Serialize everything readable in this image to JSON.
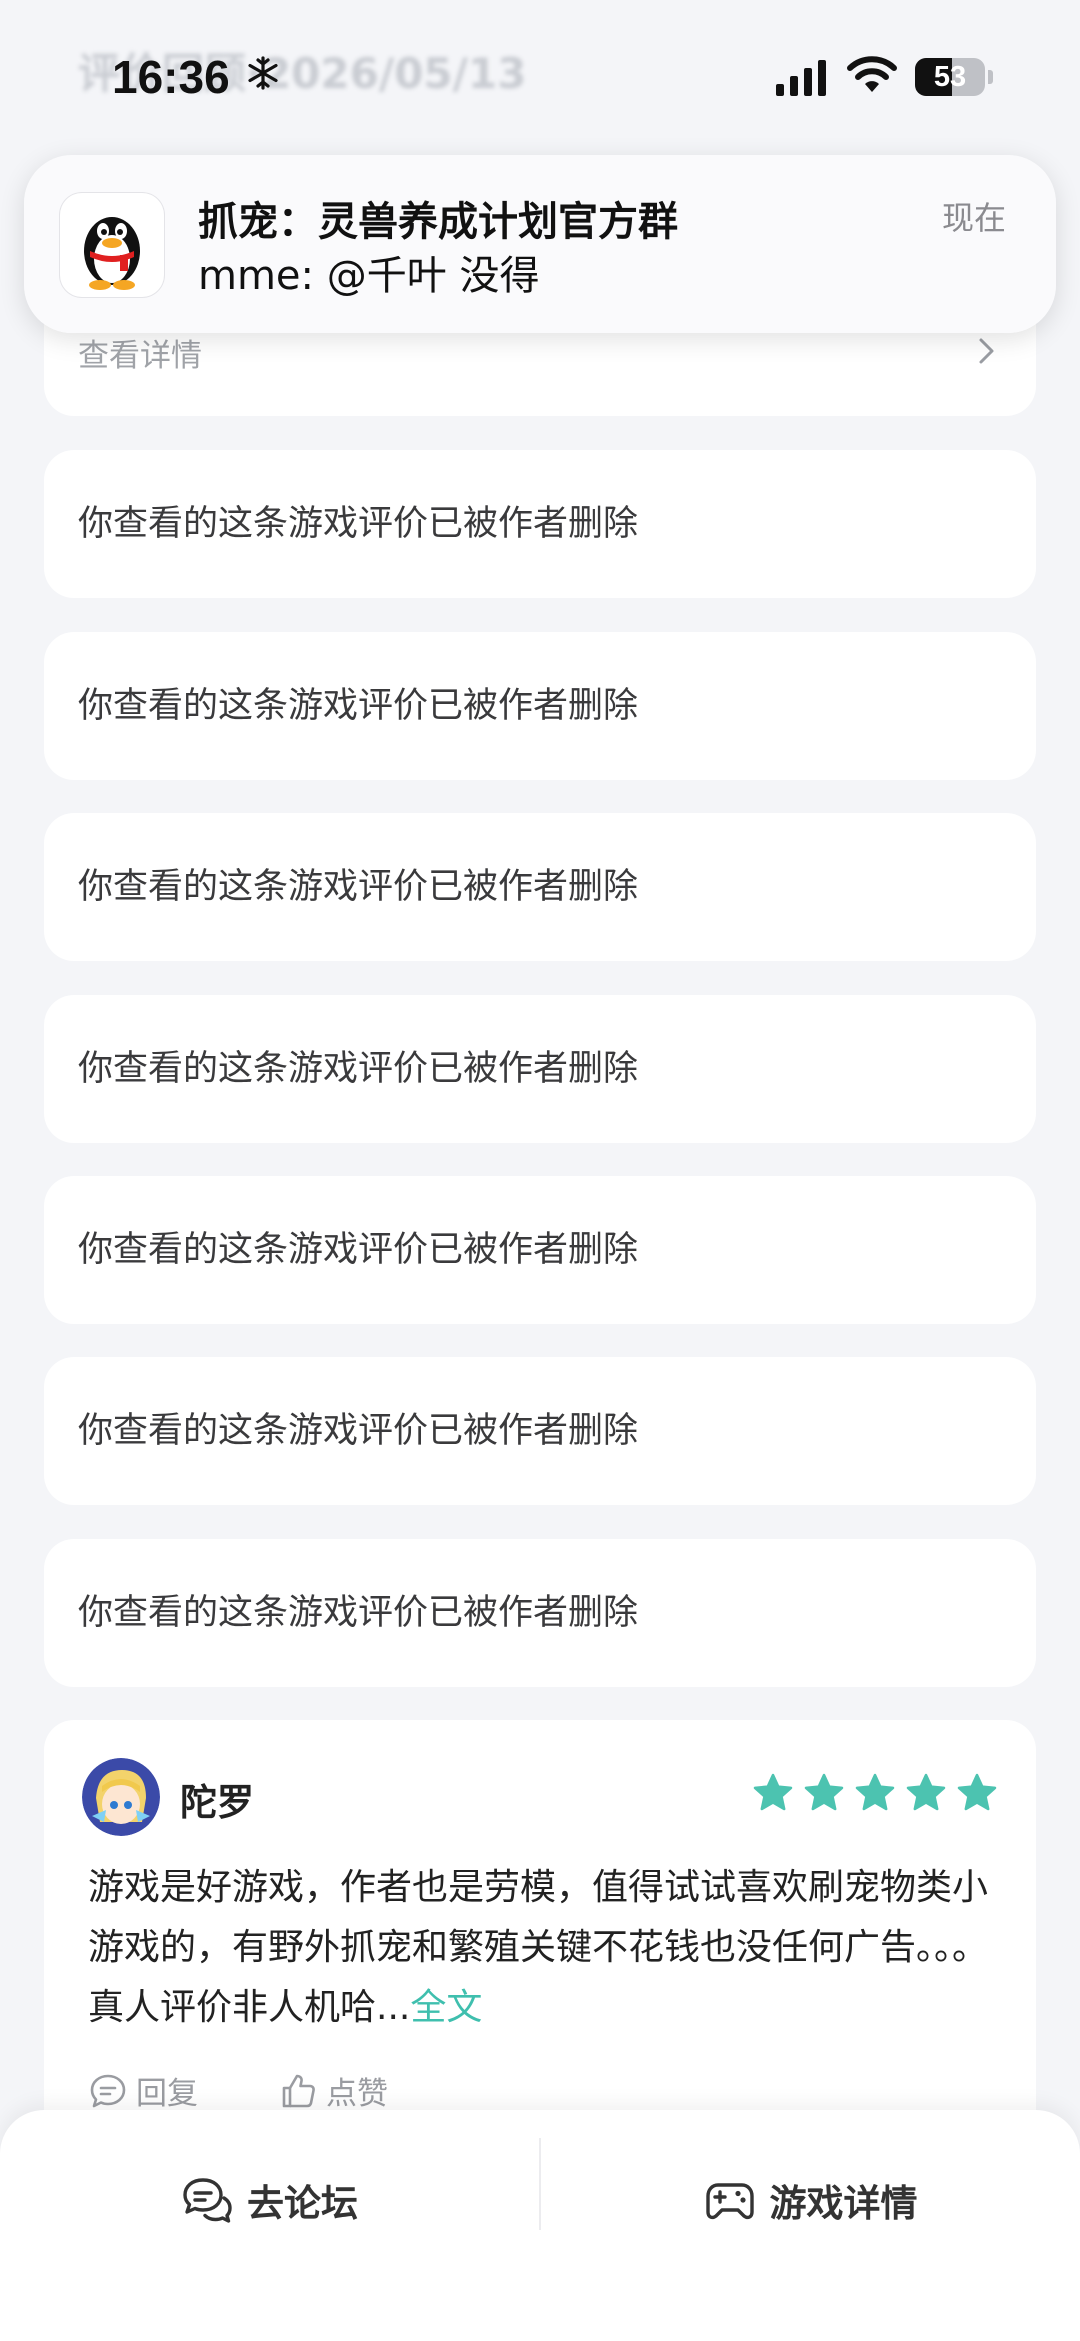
{
  "status_bar": {
    "time": "16:36",
    "battery": "53",
    "battery_level": 0.53
  },
  "background_title": "评价回顾·2026/05/13",
  "notification": {
    "title": "抓宠：灵兽养成计划官方群",
    "message": "mme: @千叶 没得",
    "time": "现在",
    "app_icon": "qq-penguin-icon"
  },
  "top_card": {
    "link_label": "查看详情"
  },
  "deleted_reviews": [
    "你查看的这条游戏评价已被作者删除",
    "你查看的这条游戏评价已被作者删除",
    "你查看的这条游戏评价已被作者删除",
    "你查看的这条游戏评价已被作者删除",
    "你查看的这条游戏评价已被作者删除",
    "你查看的这条游戏评价已被作者删除",
    "你查看的这条游戏评价已被作者删除"
  ],
  "review": {
    "author": "陀罗",
    "rating": 5,
    "star_color": "#4cc3b0",
    "body": "游戏是好游戏，作者也是劳模，值得试试喜欢刷宠物类小游戏的，有野外抓宠和繁殖关键不花钱也没任何广告。。。真人评价非人机哈...",
    "full_text_label": "全文",
    "reply_label": "回复",
    "like_label": "点赞"
  },
  "bottom_bar": {
    "forum_label": "去论坛",
    "game_detail_label": "游戏详情"
  }
}
